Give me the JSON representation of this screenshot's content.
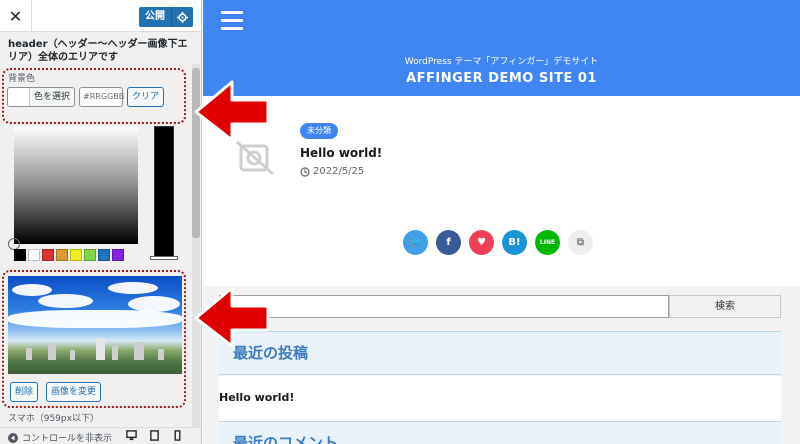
{
  "panel": {
    "close_label": "✕",
    "publish_label": "公開",
    "section_description": "header（ヘッダー〜ヘッダー画像下エリア）全体のエリアです",
    "bg_color_label": "背景色",
    "select_color_label": "色を選択",
    "hex_placeholder": "#RRGGBB",
    "clear_label": "クリア",
    "palette_colors": [
      "#000000",
      "#ffffff",
      "#dd3333",
      "#dd9933",
      "#eeee22",
      "#81d742",
      "#1e73be",
      "#8224e3"
    ],
    "remove_label": "削除",
    "change_image_label": "画像を変更",
    "smartphone_label": "スマホ（959px以下）",
    "hide_controls_label": "コントロールを非表示"
  },
  "preview": {
    "tagline": "WordPress テーマ「アフィンガー」デモサイト",
    "site_title": "AFFINGER DEMO SITE 01",
    "post": {
      "category": "未分類",
      "title": "Hello world!",
      "date": "2022/5/25"
    },
    "share_buttons": [
      {
        "name": "twitter",
        "glyph": "🐦",
        "color": "#3fa0e8"
      },
      {
        "name": "facebook",
        "glyph": "f",
        "color": "#3b5998"
      },
      {
        "name": "pocket",
        "glyph": "♥",
        "color": "#ef4056"
      },
      {
        "name": "hatena",
        "glyph": "B!",
        "color": "#1b94d6"
      },
      {
        "name": "line",
        "glyph": "LINE",
        "color": "#00b900"
      },
      {
        "name": "copy",
        "glyph": "⧉",
        "color": "#eeeeee"
      }
    ],
    "search_button_label": "検索",
    "recent_posts_heading": "最近の投稿",
    "recent_post_link": "Hello world!",
    "recent_comments_heading": "最近のコメント"
  },
  "colors": {
    "accent_blue": "#3f86f2",
    "wp_blue": "#2271b1",
    "annotation_red": "#e10000"
  }
}
